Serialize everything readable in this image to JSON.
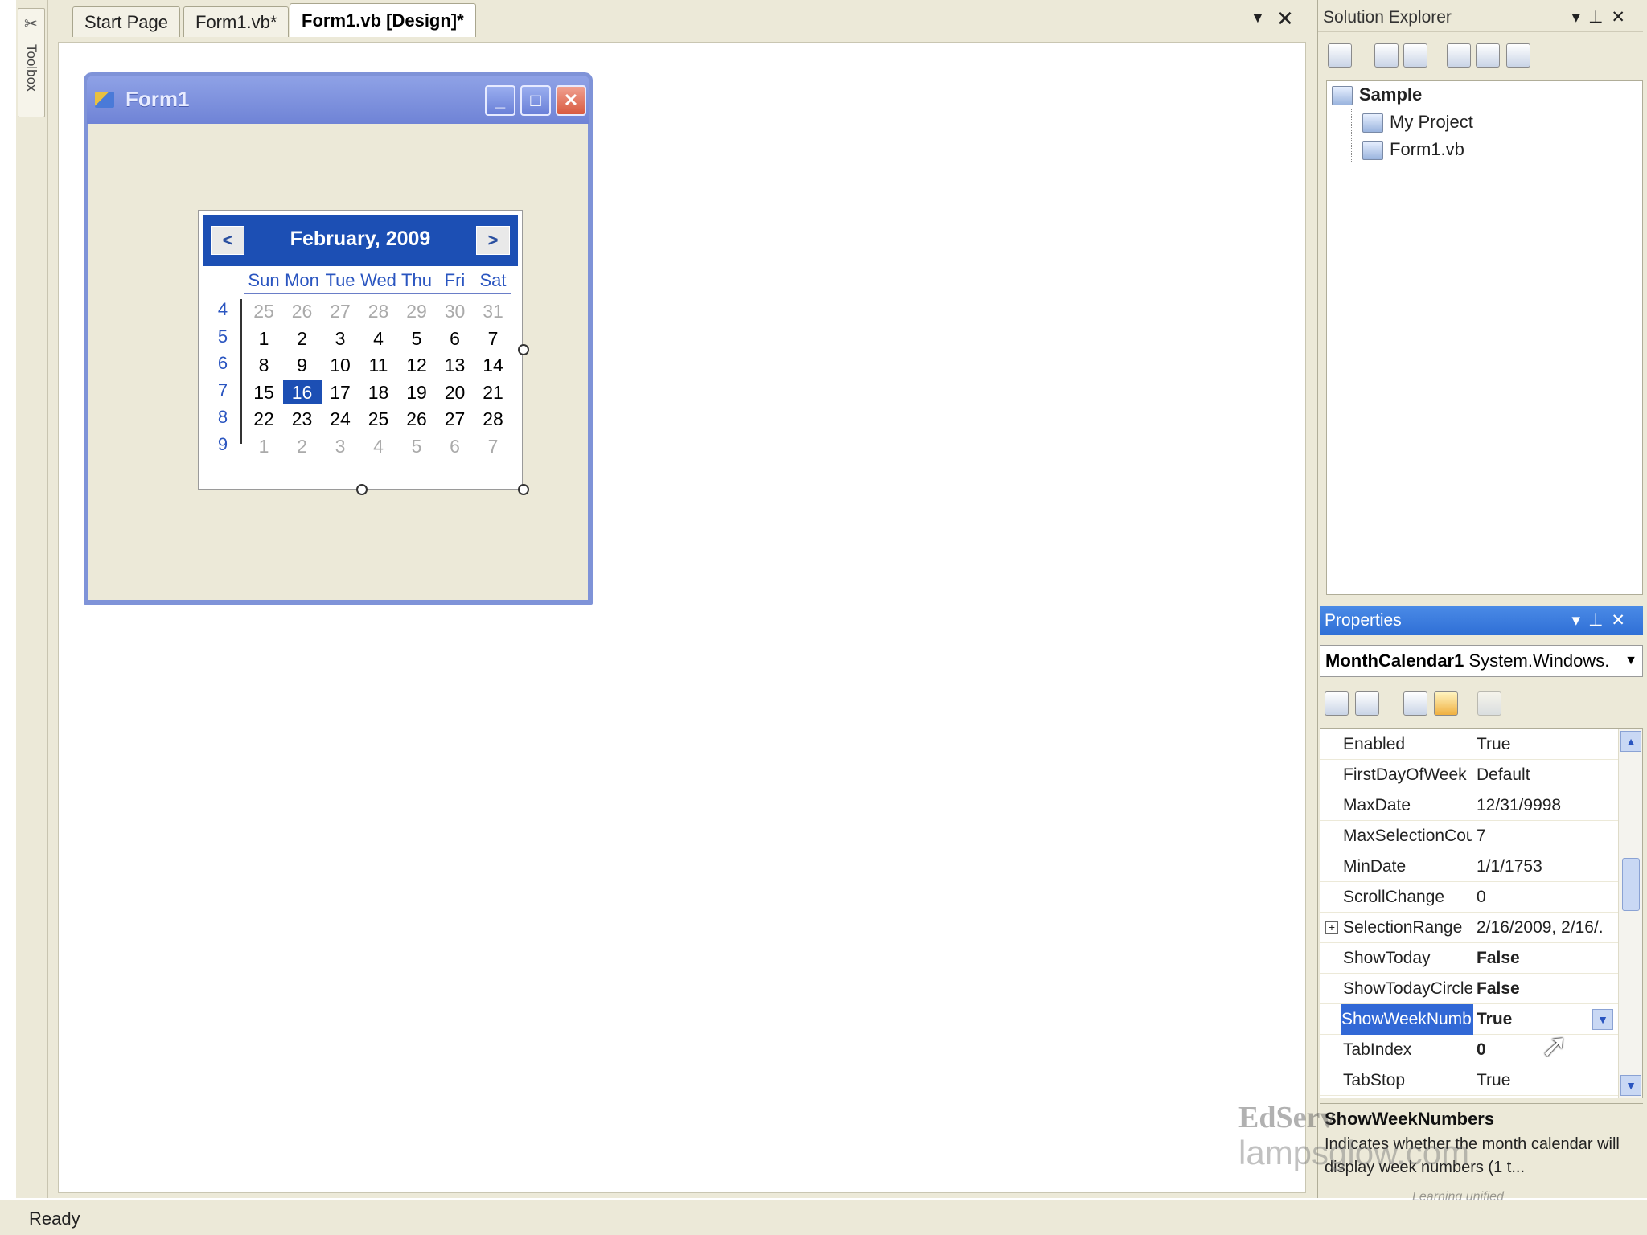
{
  "toolbox": {
    "label": "Toolbox"
  },
  "doc_tabs": [
    {
      "label": "Start Page"
    },
    {
      "label": "Form1.vb*"
    },
    {
      "label": "Form1.vb [Design]*"
    }
  ],
  "form": {
    "title": "Form1",
    "min": "_",
    "max": "□",
    "close": "✕"
  },
  "calendar": {
    "prev": "<",
    "next": ">",
    "title": "February, 2009",
    "days_of_week": [
      "Sun",
      "Mon",
      "Tue",
      "Wed",
      "Thu",
      "Fri",
      "Sat"
    ],
    "weeks": [
      {
        "num": "4",
        "days": [
          "25",
          "26",
          "27",
          "28",
          "29",
          "30",
          "31"
        ]
      },
      {
        "num": "5",
        "days": [
          "1",
          "2",
          "3",
          "4",
          "5",
          "6",
          "7"
        ]
      },
      {
        "num": "6",
        "days": [
          "8",
          "9",
          "10",
          "11",
          "12",
          "13",
          "14"
        ]
      },
      {
        "num": "7",
        "days": [
          "15",
          "16",
          "17",
          "18",
          "19",
          "20",
          "21"
        ]
      },
      {
        "num": "8",
        "days": [
          "22",
          "23",
          "24",
          "25",
          "26",
          "27",
          "28"
        ]
      },
      {
        "num": "9",
        "days": [
          "1",
          "2",
          "3",
          "4",
          "5",
          "6",
          "7"
        ]
      }
    ],
    "selected_day": "16"
  },
  "solution_explorer": {
    "title": "Solution Explorer",
    "tree": [
      "Sample",
      "My Project",
      "Form1.vb"
    ]
  },
  "properties": {
    "title": "Properties",
    "object_name": "MonthCalendar1",
    "object_type": "System.Windows.",
    "rows": [
      {
        "name": "Enabled",
        "value": "True"
      },
      {
        "name": "FirstDayOfWeek",
        "value": "Default"
      },
      {
        "name": "MaxDate",
        "value": "12/31/9998"
      },
      {
        "name": "MaxSelectionCou",
        "value": "7"
      },
      {
        "name": "MinDate",
        "value": "1/1/1753"
      },
      {
        "name": "ScrollChange",
        "value": "0"
      },
      {
        "name": "SelectionRange",
        "value": "2/16/2009, 2/16/."
      },
      {
        "name": "ShowToday",
        "value": "False"
      },
      {
        "name": "ShowTodayCircle",
        "value": "False"
      },
      {
        "name": "ShowWeekNumb",
        "value": "True"
      },
      {
        "name": "TabIndex",
        "value": "0"
      },
      {
        "name": "TabStop",
        "value": "True"
      }
    ],
    "description": {
      "title": "ShowWeekNumbers",
      "text": "Indicates whether the month calendar will display week numbers (1 t..."
    }
  },
  "status": {
    "text": "Ready"
  },
  "watermark": {
    "brand": "EdServ",
    "site": "lampsglow.com",
    "tagline": "Learning unified"
  },
  "colors": {
    "accent": "#1c4fb4",
    "form_border": "#7f93d8",
    "chrome": "#ece9d8",
    "selection": "#3168d6"
  }
}
